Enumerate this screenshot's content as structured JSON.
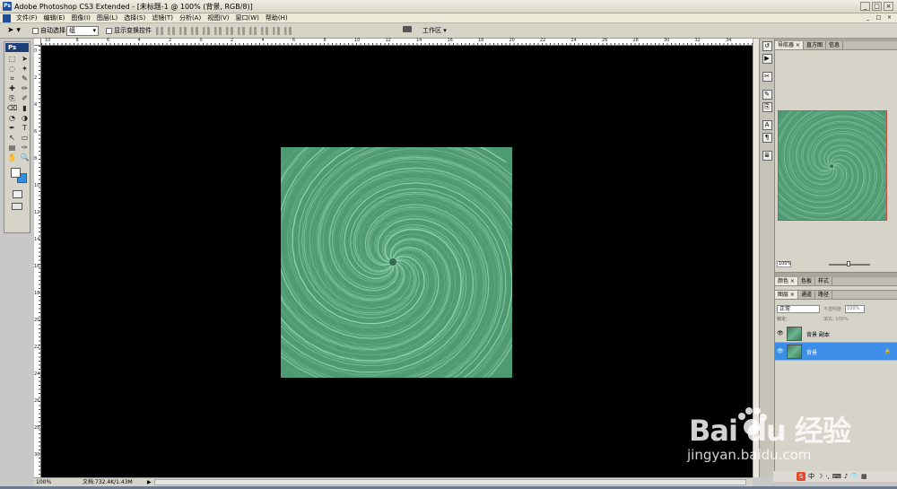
{
  "window": {
    "title": "Adobe Photoshop CS3 Extended - [未标题-1 @ 100% (背景, RGB/8)]",
    "app_icon": "Ps",
    "controls": [
      "_",
      "□",
      "×"
    ]
  },
  "menu": {
    "items": [
      "文件(F)",
      "编辑(E)",
      "图像(I)",
      "图层(L)",
      "选择(S)",
      "滤镜(T)",
      "分析(A)",
      "视图(V)",
      "窗口(W)",
      "帮助(H)"
    ],
    "doc_controls": [
      "_",
      "□",
      "×"
    ]
  },
  "options": {
    "auto_select_label": "自动选择:",
    "auto_select_value": "组",
    "show_transform_label": "显示变换控件",
    "workspace_label": "工作区 ▾"
  },
  "toolbox": {
    "logo": "Ps",
    "tools": [
      "marquee-tool",
      "move-tool",
      "lasso-tool",
      "magic-wand-tool",
      "crop-tool",
      "slice-tool",
      "healing-brush-tool",
      "brush-tool",
      "clone-stamp-tool",
      "history-brush-tool",
      "eraser-tool",
      "gradient-tool",
      "blur-tool",
      "dodge-tool",
      "pen-tool",
      "type-tool",
      "path-select-tool",
      "shape-tool",
      "notes-tool",
      "eyedropper-tool",
      "hand-tool",
      "zoom-tool"
    ],
    "tool_glyphs": [
      "⬚",
      "➤",
      "◌",
      "✦",
      "⌗",
      "✎",
      "✚",
      "✏",
      "⎘",
      "✐",
      "⌫",
      "▮",
      "◔",
      "◑",
      "✒",
      "T",
      "↖",
      "▭",
      "▤",
      "✑",
      "✋",
      "🔍"
    ],
    "foreground_color": "#ffffff",
    "background_color": "#2f8ee0"
  },
  "rulers": {
    "top_labels": [
      "10",
      "8",
      "6",
      "4",
      "2",
      "0",
      "2",
      "4",
      "6",
      "8",
      "10",
      "12",
      "14",
      "16",
      "18",
      "20",
      "22",
      "24",
      "26",
      "28",
      "30",
      "32",
      "34"
    ],
    "left_labels": [
      "0",
      "2",
      "4",
      "6",
      "8",
      "10",
      "12",
      "14",
      "16",
      "18",
      "20",
      "22",
      "24",
      "26",
      "28",
      "30"
    ]
  },
  "canvas": {
    "background_color": "#000000",
    "image_base_color": "#4f9a72",
    "image_swirl_color": "#9fe0bd"
  },
  "status": {
    "zoom": "100%",
    "doc_info": "文档:732.4K/1.43M",
    "arrow": "▶"
  },
  "navigator": {
    "tabs": [
      "导航器 ×",
      "直方图",
      "信息"
    ],
    "zoom": "100%"
  },
  "color_panel": {
    "tabs": [
      "颜色 ×",
      "色板",
      "样式"
    ]
  },
  "layers": {
    "tabs": [
      "图层 ×",
      "通道",
      "路径"
    ],
    "blend_mode": "正常",
    "opacity_label": "不透明度:",
    "opacity_value": "100%",
    "lock_label": "锁定:",
    "fill_label": "填充:",
    "fill_value": "100%",
    "items": [
      {
        "name": "背景 副本",
        "selected": false
      },
      {
        "name": "背景",
        "selected": true
      }
    ],
    "selected_color": "#3d8ee8"
  },
  "watermark": {
    "brand": "Bai du 经验",
    "url": "jingyan.baidu.com"
  },
  "tray": {
    "icons": [
      "S",
      "中",
      "☽",
      "·,",
      "⌨",
      "♪",
      "👕",
      "▦"
    ]
  }
}
